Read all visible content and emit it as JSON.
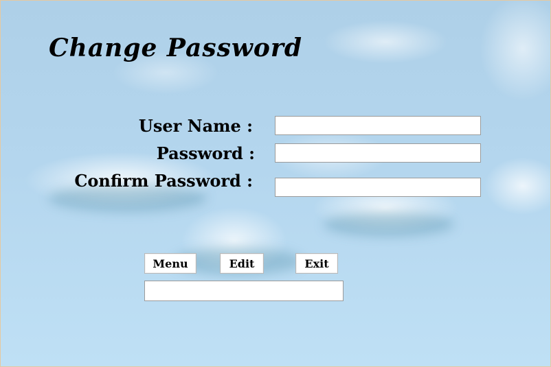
{
  "form": {
    "title": "Change Password",
    "labels": {
      "user_name": "User Name :",
      "password": "Password :",
      "confirm_password": "Confirm Password :"
    },
    "fields": {
      "user_name": "",
      "password": "",
      "confirm_password": "",
      "status": ""
    }
  },
  "buttons": {
    "menu": "Menu",
    "edit": "Edit",
    "exit": "Exit"
  }
}
